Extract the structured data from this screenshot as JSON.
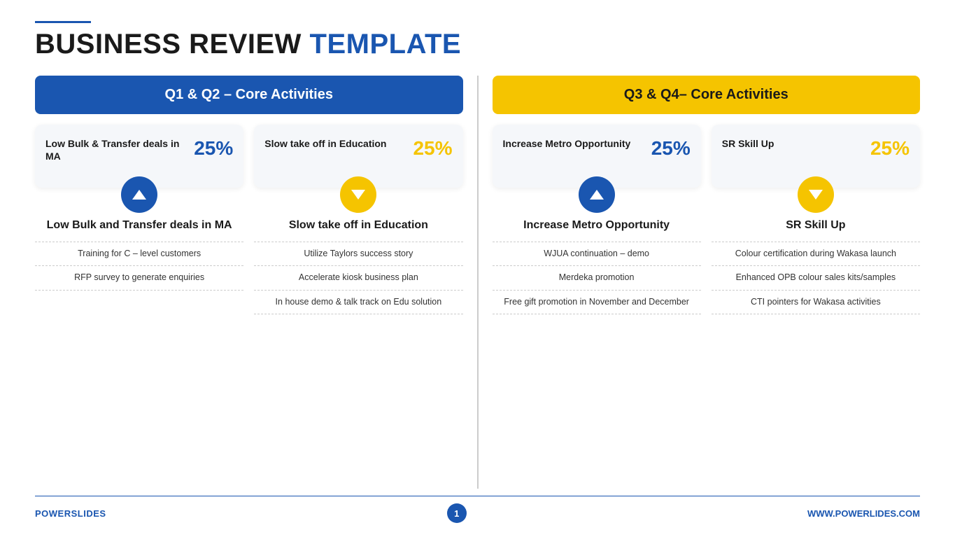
{
  "header": {
    "line_color": "#1a56b0",
    "title_dark": "BUSINESS REVIEW",
    "title_blue": " TEMPLATE"
  },
  "left_panel": {
    "header_label": "Q1 & Q2 – Core Activities",
    "header_type": "blue",
    "cards": [
      {
        "label": "Low Bulk & Transfer deals in MA",
        "percent": "25%",
        "percent_type": "blue",
        "icon_type": "blue",
        "arrow": "up"
      },
      {
        "label": "Slow take off in Education",
        "percent": "25%",
        "percent_type": "yellow",
        "icon_type": "yellow",
        "arrow": "down"
      }
    ],
    "section_titles": [
      "Low Bulk and Transfer deals in MA",
      "Slow take off in Education"
    ],
    "bullet_lists": [
      [
        "Training for C – level customers",
        "RFP survey to generate enquiries"
      ],
      [
        "Utilize Taylors success story",
        "Accelerate kiosk business plan",
        "In house demo & talk track on Edu solution"
      ]
    ]
  },
  "right_panel": {
    "header_label": "Q3 & Q4– Core Activities",
    "header_type": "yellow",
    "cards": [
      {
        "label": "Increase Metro Opportunity",
        "percent": "25%",
        "percent_type": "blue",
        "icon_type": "blue",
        "arrow": "up"
      },
      {
        "label": "SR Skill Up",
        "percent": "25%",
        "percent_type": "yellow",
        "icon_type": "yellow",
        "arrow": "down"
      }
    ],
    "section_titles": [
      "Increase Metro Opportunity",
      "SR Skill Up"
    ],
    "bullet_lists": [
      [
        "WJUA continuation – demo",
        "Merdeka promotion",
        "Free gift promotion in November and December"
      ],
      [
        "Colour certification during Wakasa launch",
        "Enhanced OPB colour sales kits/samples",
        "CTI pointers for Wakasa activities"
      ]
    ]
  },
  "footer": {
    "brand_dark": "POWER",
    "brand_blue": "SLIDES",
    "page_number": "1",
    "url": "WWW.POWERLIDES.COM"
  }
}
